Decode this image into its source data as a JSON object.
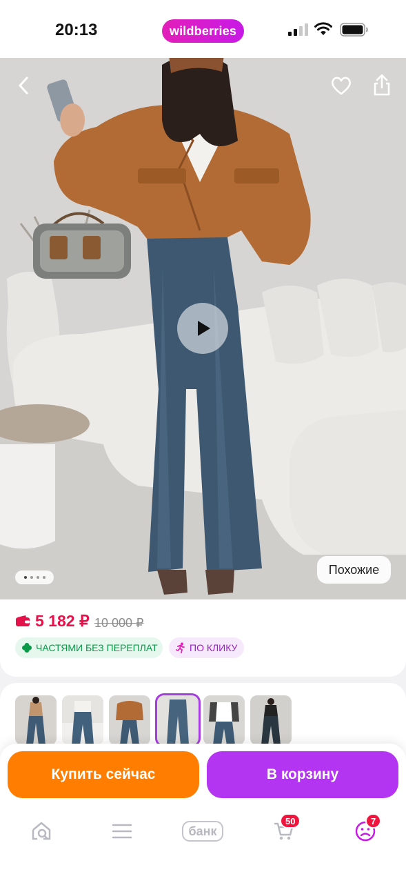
{
  "status_bar": {
    "time": "20:13",
    "brand": "wildberries",
    "icons": [
      "signal-icon",
      "wifi-icon",
      "battery-icon"
    ]
  },
  "hero": {
    "back_icon": "chevron-left-icon",
    "favorite_icon": "heart-icon",
    "share_icon": "share-icon",
    "play_icon": "play-icon",
    "image_count": 4,
    "current_image": 1,
    "similar_label": "Похожие"
  },
  "price": {
    "current": "5 182 ₽",
    "old": "10 000 ₽",
    "currency_icon": "wallet-icon",
    "color": "#e3124a"
  },
  "badges": [
    {
      "label": "ЧАСТЯМИ БЕЗ ПЕРЕПЛАТ",
      "icon": "clover-icon",
      "color": "#0a9a4a"
    },
    {
      "label": "ПО КЛИКУ",
      "icon": "running-man-icon",
      "color": "#9b1fc7"
    }
  ],
  "thumbnails": {
    "count": 6,
    "selected_index": 3
  },
  "actions": {
    "buy_now": "Купить сейчас",
    "add_to_cart": "В корзину",
    "buy_color": "#ff7d00",
    "cart_color": "#b335f2"
  },
  "bottom_nav": {
    "items": [
      {
        "name": "home",
        "icon": "home-search-icon"
      },
      {
        "name": "catalog",
        "icon": "menu-icon"
      },
      {
        "name": "bank",
        "label": "банк"
      },
      {
        "name": "cart",
        "icon": "cart-icon",
        "badge": "50"
      },
      {
        "name": "profile",
        "icon": "profile-icon",
        "badge": "7"
      }
    ]
  }
}
